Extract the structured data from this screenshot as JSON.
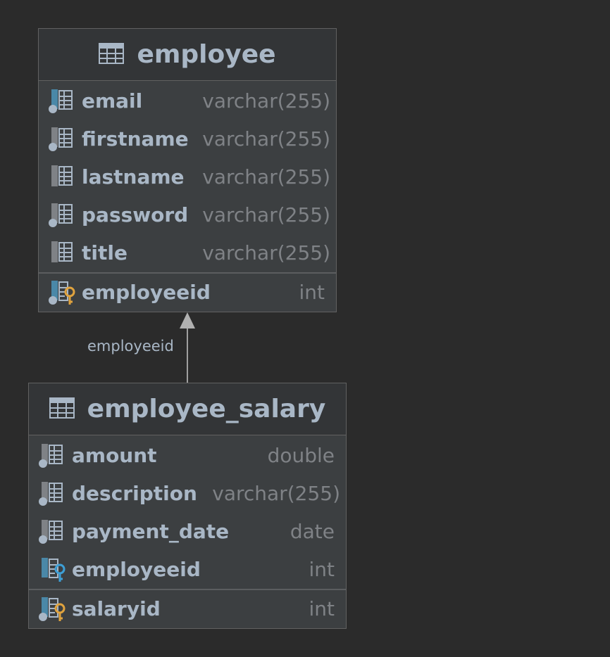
{
  "entities": [
    {
      "name": "employee",
      "columns": [
        {
          "name": "email",
          "type": "varchar(255)",
          "icon": "column-notnull-icon"
        },
        {
          "name": "firstname",
          "type": "varchar(255)",
          "icon": "column-notnull-icon"
        },
        {
          "name": "lastname",
          "type": "varchar(255)",
          "icon": "column-icon"
        },
        {
          "name": "password",
          "type": "varchar(255)",
          "icon": "column-notnull-icon"
        },
        {
          "name": "title",
          "type": "varchar(255)",
          "icon": "column-icon"
        }
      ],
      "primary_key": [
        {
          "name": "employeeid",
          "type": "int",
          "icon": "primary-key-icon"
        }
      ]
    },
    {
      "name": "employee_salary",
      "columns": [
        {
          "name": "amount",
          "type": "double",
          "icon": "column-notnull-icon"
        },
        {
          "name": "description",
          "type": "varchar(255)",
          "icon": "column-notnull-icon"
        },
        {
          "name": "payment_date",
          "type": "date",
          "icon": "column-notnull-icon"
        },
        {
          "name": "employeeid",
          "type": "int",
          "icon": "foreign-key-icon"
        }
      ],
      "primary_key": [
        {
          "name": "salaryid",
          "type": "int",
          "icon": "primary-key-icon"
        }
      ]
    }
  ],
  "relation": {
    "label": "employeeid"
  },
  "colors": {
    "background": "#2b2b2b",
    "entity_body": "#3c3f41",
    "entity_header": "#333537",
    "text": "#a9b7c6",
    "type_text": "#7f8286",
    "primary_key": "#e0a33e",
    "foreign_key": "#3d9fd6",
    "column_accent": "#4a88a8"
  }
}
